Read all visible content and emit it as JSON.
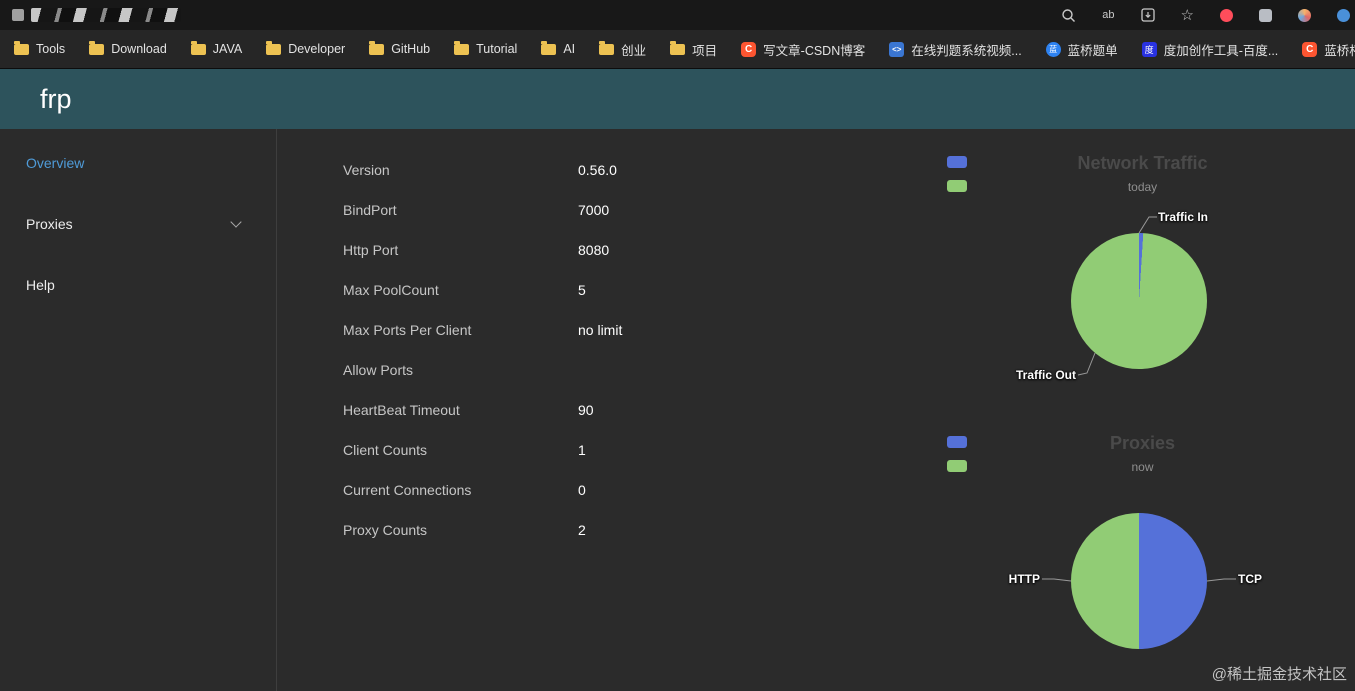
{
  "browser": {
    "tab": {
      "title_redacted": true
    },
    "topbar_icons": [
      "search-icon",
      "translate-icon",
      "save-icon",
      "star-icon",
      "extension-red-icon",
      "extension-gray-icon",
      "extension-orange-icon",
      "extension-blue-icon"
    ],
    "icon_glyphs": {
      "translate": "ab",
      "star": "☆"
    },
    "bookmarks": [
      {
        "label": "Tools",
        "icon": "folder",
        "icon_text": ""
      },
      {
        "label": "Download",
        "icon": "folder",
        "icon_text": ""
      },
      {
        "label": "JAVA",
        "icon": "folder",
        "icon_text": ""
      },
      {
        "label": "Developer",
        "icon": "folder",
        "icon_text": ""
      },
      {
        "label": "GitHub",
        "icon": "folder",
        "icon_text": ""
      },
      {
        "label": "Tutorial",
        "icon": "folder",
        "icon_text": ""
      },
      {
        "label": "AI",
        "icon": "folder",
        "icon_text": ""
      },
      {
        "label": "创业",
        "icon": "folder",
        "icon_text": ""
      },
      {
        "label": "项目",
        "icon": "folder",
        "icon_text": ""
      },
      {
        "label": "写文章-CSDN博客",
        "icon": "csdn",
        "icon_text": "C"
      },
      {
        "label": "在线判题系统视频...",
        "icon": "code",
        "icon_text": "<>"
      },
      {
        "label": "蓝桥题单",
        "icon": "lanqiao",
        "icon_text": "蓝"
      },
      {
        "label": "度加创作工具-百度...",
        "icon": "baidu",
        "icon_text": "度"
      },
      {
        "label": "蓝桥杯JAVA-知识点...",
        "icon": "csdn",
        "icon_text": "C"
      }
    ]
  },
  "header": {
    "title": "frp"
  },
  "sidebar": {
    "items": [
      {
        "label": "Overview",
        "active": true,
        "expandable": false
      },
      {
        "label": "Proxies",
        "active": false,
        "expandable": true
      },
      {
        "label": "Help",
        "active": false,
        "expandable": false
      }
    ]
  },
  "overview": {
    "rows": [
      {
        "label": "Version",
        "value": "0.56.0"
      },
      {
        "label": "BindPort",
        "value": "7000"
      },
      {
        "label": "Http Port",
        "value": "8080"
      },
      {
        "label": "Max PoolCount",
        "value": "5"
      },
      {
        "label": "Max Ports Per Client",
        "value": "no limit"
      },
      {
        "label": "Allow Ports",
        "value": ""
      },
      {
        "label": "HeartBeat Timeout",
        "value": "90"
      },
      {
        "label": "Client Counts",
        "value": "1"
      },
      {
        "label": "Current Connections",
        "value": "0"
      },
      {
        "label": "Proxy Counts",
        "value": "2"
      }
    ]
  },
  "chart_data": [
    {
      "type": "pie",
      "title": "Network Traffic",
      "subtitle": "today",
      "legend_position": "top-left",
      "series": [
        {
          "name": "Traffic In",
          "value": 1,
          "color": "#5571d9"
        },
        {
          "name": "Traffic Out",
          "value": 99,
          "color": "#91cc75"
        }
      ]
    },
    {
      "type": "pie",
      "title": "Proxies",
      "subtitle": "now",
      "legend_position": "top-left",
      "series": [
        {
          "name": "TCP",
          "value": 1,
          "color": "#5571d9"
        },
        {
          "name": "HTTP",
          "value": 1,
          "color": "#91cc75"
        }
      ]
    }
  ],
  "watermark": "@稀土掘金技术社区",
  "colors": {
    "header_bg": "#2d535c",
    "active_link": "#4f9bd8",
    "pie_blue": "#5571d9",
    "pie_green": "#91cc75"
  }
}
